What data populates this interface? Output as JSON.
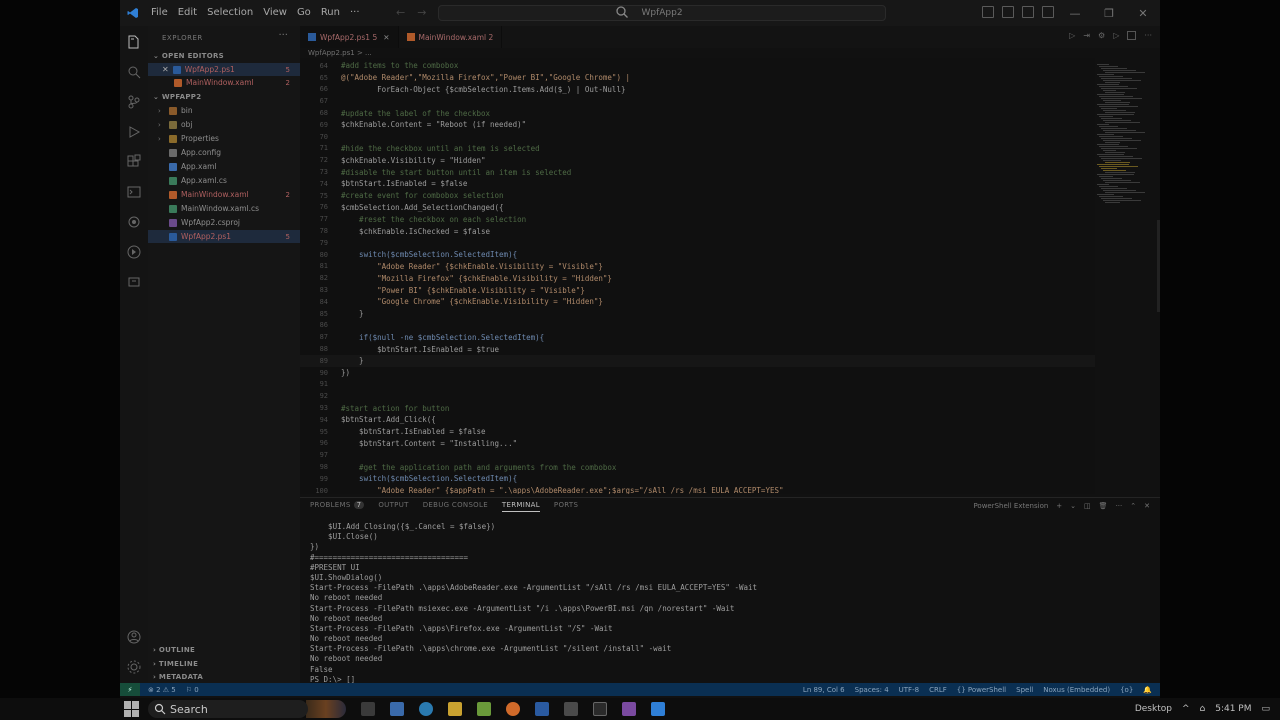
{
  "titlebar": {
    "menu": [
      "File",
      "Edit",
      "Selection",
      "View",
      "Go",
      "Run",
      "···"
    ],
    "command_center": "WpfApp2"
  },
  "sidebar": {
    "title": "EXPLORER",
    "more": "···",
    "open_editors_label": "OPEN EDITORS",
    "open_editors": [
      {
        "name": "WpfApp2.ps1",
        "badge": "5"
      },
      {
        "name": "MainWindow.xaml",
        "badge": "2"
      }
    ],
    "project_label": "WPFAPP2",
    "tree": [
      {
        "name": "bin",
        "kind": "folder"
      },
      {
        "name": "obj",
        "kind": "folder"
      },
      {
        "name": "Properties",
        "kind": "folder"
      },
      {
        "name": "App.config",
        "kind": "file"
      },
      {
        "name": "App.xaml",
        "kind": "file"
      },
      {
        "name": "App.xaml.cs",
        "kind": "file"
      },
      {
        "name": "MainWindow.xaml",
        "kind": "file",
        "badge": "2"
      },
      {
        "name": "MainWindow.xaml.cs",
        "kind": "file"
      },
      {
        "name": "WpfApp2.csproj",
        "kind": "file"
      },
      {
        "name": "WpfApp2.ps1",
        "kind": "file",
        "badge": "5"
      }
    ],
    "bottom_sections": [
      "OUTLINE",
      "TIMELINE",
      "METADATA"
    ]
  },
  "tabs": [
    {
      "label": "WpfApp2.ps1 5",
      "active": true
    },
    {
      "label": "MainWindow.xaml 2",
      "active": false
    }
  ],
  "breadcrumb": "WpfApp2.ps1 > ...",
  "code": [
    {
      "n": "64",
      "t": "#add items to the combobox",
      "c": "cm"
    },
    {
      "n": "65",
      "t": "@(\"Adobe Reader\",\"Mozilla Firefox\",\"Power BI\",\"Google Chrome\") |",
      "c": "st"
    },
    {
      "n": "66",
      "t": "        ForEach-Object {$cmbSelection.Items.Add($_) | Out-Null}",
      "c": ""
    },
    {
      "n": "67",
      "t": "",
      "c": ""
    },
    {
      "n": "68",
      "t": "#update the label of the checkbox",
      "c": "cm"
    },
    {
      "n": "69",
      "t": "$chkEnable.Content = \"Reboot (if needed)\"",
      "c": ""
    },
    {
      "n": "70",
      "t": "",
      "c": ""
    },
    {
      "n": "71",
      "t": "#hide the checkbox until an item is selected",
      "c": "cm"
    },
    {
      "n": "72",
      "t": "$chkEnable.Visibility = \"Hidden\"",
      "c": ""
    },
    {
      "n": "73",
      "t": "#disable the start button until an item is selected",
      "c": "cm"
    },
    {
      "n": "74",
      "t": "$btnStart.IsEnabled = $false",
      "c": ""
    },
    {
      "n": "75",
      "t": "#create event for combobox selection",
      "c": "cm"
    },
    {
      "n": "76",
      "t": "$cmbSelection.Add_SelectionChanged({",
      "c": ""
    },
    {
      "n": "77",
      "t": "    #reset the checkbox on each selection",
      "c": "cm"
    },
    {
      "n": "78",
      "t": "    $chkEnable.IsChecked = $false",
      "c": ""
    },
    {
      "n": "79",
      "t": "",
      "c": ""
    },
    {
      "n": "80",
      "t": "    switch($cmbSelection.SelectedItem){",
      "c": "kw"
    },
    {
      "n": "81",
      "t": "        \"Adobe Reader\" {$chkEnable.Visibility = \"Visible\"}",
      "c": "st"
    },
    {
      "n": "82",
      "t": "        \"Mozilla Firefox\" {$chkEnable.Visibility = \"Hidden\"}",
      "c": "st"
    },
    {
      "n": "83",
      "t": "        \"Power BI\" {$chkEnable.Visibility = \"Visible\"}",
      "c": "st"
    },
    {
      "n": "84",
      "t": "        \"Google Chrome\" {$chkEnable.Visibility = \"Hidden\"}",
      "c": "st"
    },
    {
      "n": "85",
      "t": "    }",
      "c": ""
    },
    {
      "n": "86",
      "t": "",
      "c": ""
    },
    {
      "n": "87",
      "t": "    if($null -ne $cmbSelection.SelectedItem){",
      "c": "kw"
    },
    {
      "n": "88",
      "t": "        $btnStart.IsEnabled = $true",
      "c": ""
    },
    {
      "n": "89",
      "t": "    }",
      "c": "cur"
    },
    {
      "n": "90",
      "t": "})",
      "c": ""
    },
    {
      "n": "91",
      "t": "",
      "c": ""
    },
    {
      "n": "92",
      "t": "",
      "c": ""
    },
    {
      "n": "93",
      "t": "#start action for button",
      "c": "cm"
    },
    {
      "n": "94",
      "t": "$btnStart.Add_Click({",
      "c": ""
    },
    {
      "n": "95",
      "t": "    $btnStart.IsEnabled = $false",
      "c": ""
    },
    {
      "n": "96",
      "t": "    $btnStart.Content = \"Installing...\"",
      "c": ""
    },
    {
      "n": "97",
      "t": "",
      "c": ""
    },
    {
      "n": "98",
      "t": "    #get the application path and arguments from the combobox",
      "c": "cm"
    },
    {
      "n": "99",
      "t": "    switch($cmbSelection.SelectedItem){",
      "c": "kw"
    },
    {
      "n": "100",
      "t": "        \"Adobe Reader\" {$appPath = \".\\apps\\AdobeReader.exe\";$args=\"/sAll /rs /msi EULA_ACCEPT=YES\"",
      "c": "st"
    }
  ],
  "panel": {
    "tabs": [
      "PROBLEMS",
      "OUTPUT",
      "DEBUG CONSOLE",
      "TERMINAL",
      "PORTS"
    ],
    "problems_count": "7",
    "active_tab": "TERMINAL",
    "terminal_name": "PowerShell Extension",
    "add_label": "+",
    "terminal_lines": [
      "    $UI.Add_Closing({$_.Cancel = $false})",
      "    $UI.Close()",
      "})",
      "#==================================",
      "#PRESENT UI",
      "$UI.ShowDialog()",
      "Start-Process -FilePath .\\apps\\AdobeReader.exe -ArgumentList \"/sAll /rs /msi EULA_ACCEPT=YES\" -Wait",
      "No reboot needed",
      "Start-Process -FilePath msiexec.exe -ArgumentList \"/i .\\apps\\PowerBI.msi /qn /norestart\" -Wait",
      "No reboot needed",
      "Start-Process -FilePath .\\apps\\Firefox.exe -ArgumentList \"/S\" -Wait",
      "No reboot needed",
      "Start-Process -FilePath .\\apps\\chrome.exe -ArgumentList \"/silent /install\" -wait",
      "No reboot needed",
      "False",
      "PS D:\\> []"
    ]
  },
  "statusbar": {
    "remote": "⚡",
    "problems": "⊗ 2 ⚠ 5",
    "ports": "⚐ 0",
    "position": "Ln 89, Col 6",
    "spaces": "Spaces: 4",
    "encoding": "UTF-8",
    "eol": "CRLF",
    "language": "{} PowerShell",
    "spell": "Spell",
    "ai": "Noxus (Embedded)",
    "extra": "{o}"
  },
  "taskbar": {
    "search_label": "Search",
    "desktop_label": "Desktop",
    "time": "5:41 PM"
  },
  "colors": {
    "statusbar": "#0a2f52",
    "accent_blue": "#2f7fd6",
    "error_red": "#c25050"
  }
}
